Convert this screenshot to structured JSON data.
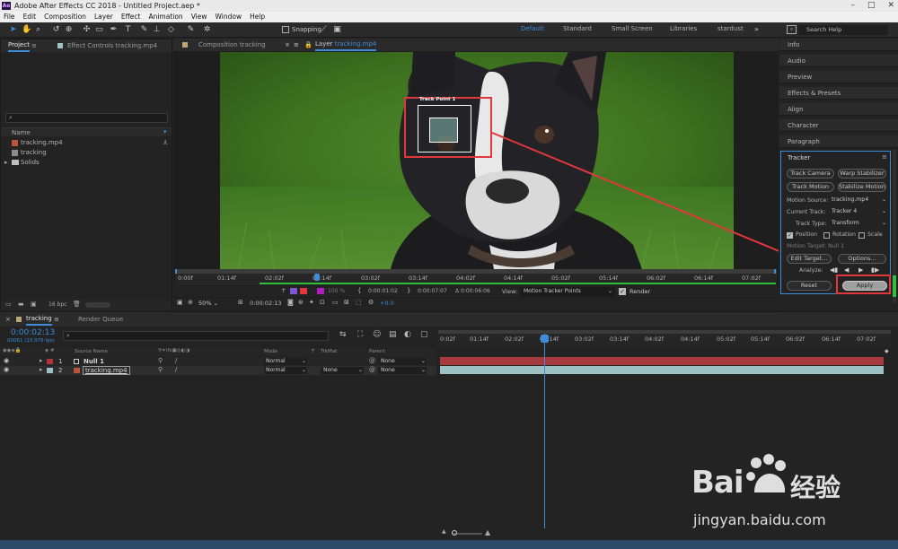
{
  "window": {
    "title": "Adobe After Effects CC 2018 - Untitled Project.aep *",
    "logo": "Ae"
  },
  "menu": [
    "File",
    "Edit",
    "Composition",
    "Layer",
    "Effect",
    "Animation",
    "View",
    "Window",
    "Help"
  ],
  "toolbar": {
    "snapping": "Snapping",
    "search_placeholder": "Search Help"
  },
  "workspaces": [
    {
      "label": "Default",
      "active": true
    },
    {
      "label": "Standard",
      "active": false
    },
    {
      "label": "Small Screen",
      "active": false
    },
    {
      "label": "Libraries",
      "active": false
    },
    {
      "label": "stardust",
      "active": false
    }
  ],
  "project": {
    "tab": "Project",
    "effect_tab": "Effect Controls tracking.mp4",
    "col_name": "Name",
    "items": [
      {
        "name": "tracking.mp4",
        "icon": "video-file-icon"
      },
      {
        "name": "tracking",
        "icon": "composition-icon"
      },
      {
        "name": "Solids",
        "icon": "folder-icon"
      }
    ],
    "bpc": "16 bpc"
  },
  "viewer": {
    "comp_tab": "Composition tracking",
    "layer_tab_prefix": "Layer",
    "layer_tab_name": "tracking.mp4",
    "track_point": "Track Point 1",
    "ruler": [
      "0:00f",
      "01:14f",
      "02:02f",
      "02:14f",
      "03:02f",
      "03:14f",
      "04:02f",
      "04:14f",
      "05:02f",
      "05:14f",
      "06:02f",
      "06:14f",
      "07:02f"
    ],
    "zoom_level": "50%",
    "timecode": "0:00:02:13",
    "in_point": "0:00:01:02",
    "out_point": "0:00:07:07",
    "duration": "Δ 0:00:06:06",
    "view_label": "View:",
    "view_value": "Motion Tracker Points",
    "render": "Render",
    "exposure": "+0.0",
    "res_pct": "100 %",
    "res_mode": "(Full)"
  },
  "right_panels": [
    "Info",
    "Audio",
    "Preview",
    "Effects & Presets",
    "Align",
    "Character",
    "Paragraph"
  ],
  "tracker": {
    "title": "Tracker",
    "track_camera": "Track Camera",
    "warp_stabilizer": "Warp Stabilizer",
    "track_motion": "Track Motion",
    "stabilize_motion": "Stabilize Motion",
    "motion_source_label": "Motion Source:",
    "motion_source": "tracking.mp4",
    "current_track_label": "Current Track:",
    "current_track": "Tracker 4",
    "track_type_label": "Track Type:",
    "track_type": "Transform",
    "position": "Position",
    "rotation": "Rotation",
    "scale": "Scale",
    "motion_target": "Motion Target: Null 1",
    "edit_target": "Edit Target...",
    "options": "Options...",
    "analyze": "Analyze:",
    "reset": "Reset",
    "apply": "Apply"
  },
  "timeline": {
    "tab": "tracking",
    "render_queue": "Render Queue",
    "timecode": "0:00:02:13",
    "fps": "00061 (23.976 fps)",
    "cols": {
      "source": "Source Name",
      "mode": "Mode",
      "t": "T",
      "trkmat": "TrkMat",
      "parent": "Parent"
    },
    "layers": [
      {
        "num": "1",
        "name": "Null 1",
        "color": "#b1343a",
        "mode": "Normal",
        "trkmat": "",
        "parent": "None"
      },
      {
        "num": "2",
        "name": "tracking.mp4",
        "color": "#9ec1c5",
        "mode": "Normal",
        "trkmat": "None",
        "parent": "None"
      }
    ],
    "ruler": [
      "0:02f",
      "01:14f",
      "02:02f",
      "02:14f",
      "03:02f",
      "03:14f",
      "04:02f",
      "04:14f",
      "05:02f",
      "05:14f",
      "06:02f",
      "06:14f",
      "07:02f"
    ]
  },
  "watermark": {
    "brand": "Bai",
    "brand2": "经验",
    "url": "jingyan.baidu.com"
  },
  "colors": {
    "accent": "#3d8dd9",
    "highlight": "#e0383d"
  }
}
